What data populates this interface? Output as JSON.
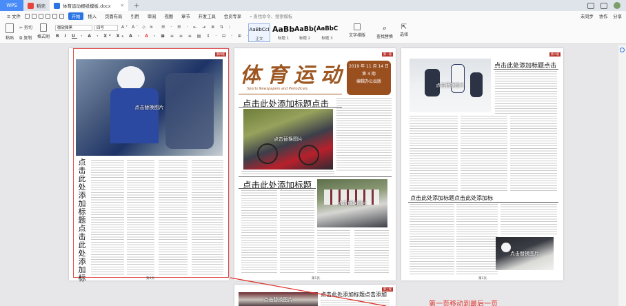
{
  "titlebar": {
    "app": "WPS",
    "tabs": [
      {
        "label": "稻壳",
        "color": "#e8423d"
      },
      {
        "label": "体育运动报纸模板.docx",
        "color": "#2b74e4",
        "active": true
      }
    ],
    "new_tab": "+"
  },
  "menubar": {
    "file": "≡ 文件",
    "items": [
      "开始",
      "插入",
      "页面布局",
      "引用",
      "审阅",
      "视图",
      "章节",
      "开发工具",
      "会员专享"
    ],
    "search": "查找命令、搜索模板",
    "right": [
      "未同步",
      "协作",
      "分享"
    ]
  },
  "ribbon": {
    "paste": "粘贴",
    "cut": "剪切",
    "copy": "复制",
    "format_painter": "格式刷",
    "font_name": "微软雅黑",
    "font_size": "四号",
    "styles": [
      {
        "sample": "AaBbCcI",
        "label": "正文"
      },
      {
        "sample": "AaBb",
        "label": "标题 1"
      },
      {
        "sample": "AaBb(",
        "label": "标题 2"
      },
      {
        "sample": "AaBbC",
        "label": "标题 3"
      }
    ],
    "text_layout": "文字排版",
    "find_replace": "查找替换",
    "select": "选择"
  },
  "pages": {
    "left": {
      "tag": "第四版",
      "photo_caption": "点击替换图片",
      "vertical_title": "点击此处添加标题点击此处添加标",
      "page_no": "第4页."
    },
    "middle": {
      "tag": "第一版",
      "masthead": "体育运动",
      "masthead_sub": "Sports Newspapers and Periodicals.",
      "date": "2019 年 11 月 14 日",
      "issue": "第 4 期",
      "publisher": "编辑办公出版",
      "title1": "点击此处添加标题点击",
      "photo1_caption": "点击替换图片",
      "title2": "点击此处添加标题",
      "photo2_caption": "点击替换图片",
      "page_no": "第1页."
    },
    "right": {
      "tag": "第二版",
      "title1": "点击此处添加标题点击",
      "photo1_caption": "点击替换图片",
      "title2": "点击此处添加标题点击此处添加标",
      "photo2_caption": "点击替换图片",
      "page_no": "第2页."
    },
    "bottom": {
      "tag": "第三版",
      "title": "点击此处添加标题点击添加",
      "photo_caption": "点击替换图片"
    }
  },
  "annotation": "第一页移动到最后一页"
}
